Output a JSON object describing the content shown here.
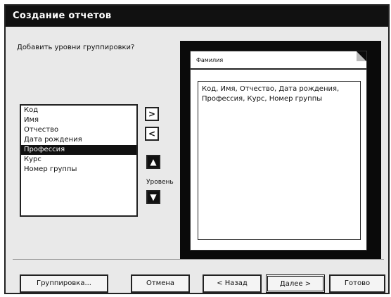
{
  "window": {
    "title": "Создание отчетов"
  },
  "prompt": "Добавить уровни группировки?",
  "fields": [
    "Код",
    "Имя",
    "Отчество",
    "Дата рождения",
    "Профессия",
    "Курс",
    "Номер группы"
  ],
  "selected_field_index": 4,
  "transfer_buttons": {
    "add": ">",
    "remove": "<"
  },
  "priority_buttons": {
    "up": "▲",
    "down": "▼"
  },
  "level_label": "Уровень",
  "preview": {
    "header_text": "Фамилия",
    "box_text": "Код, Имя, Отчество, Дата рождения, Профессия, Курс, Номер группы"
  },
  "buttons": {
    "grouping": "Группировка...",
    "cancel": "Отмена",
    "back": "< Назад",
    "next": "Далее >",
    "finish": "Готово"
  }
}
